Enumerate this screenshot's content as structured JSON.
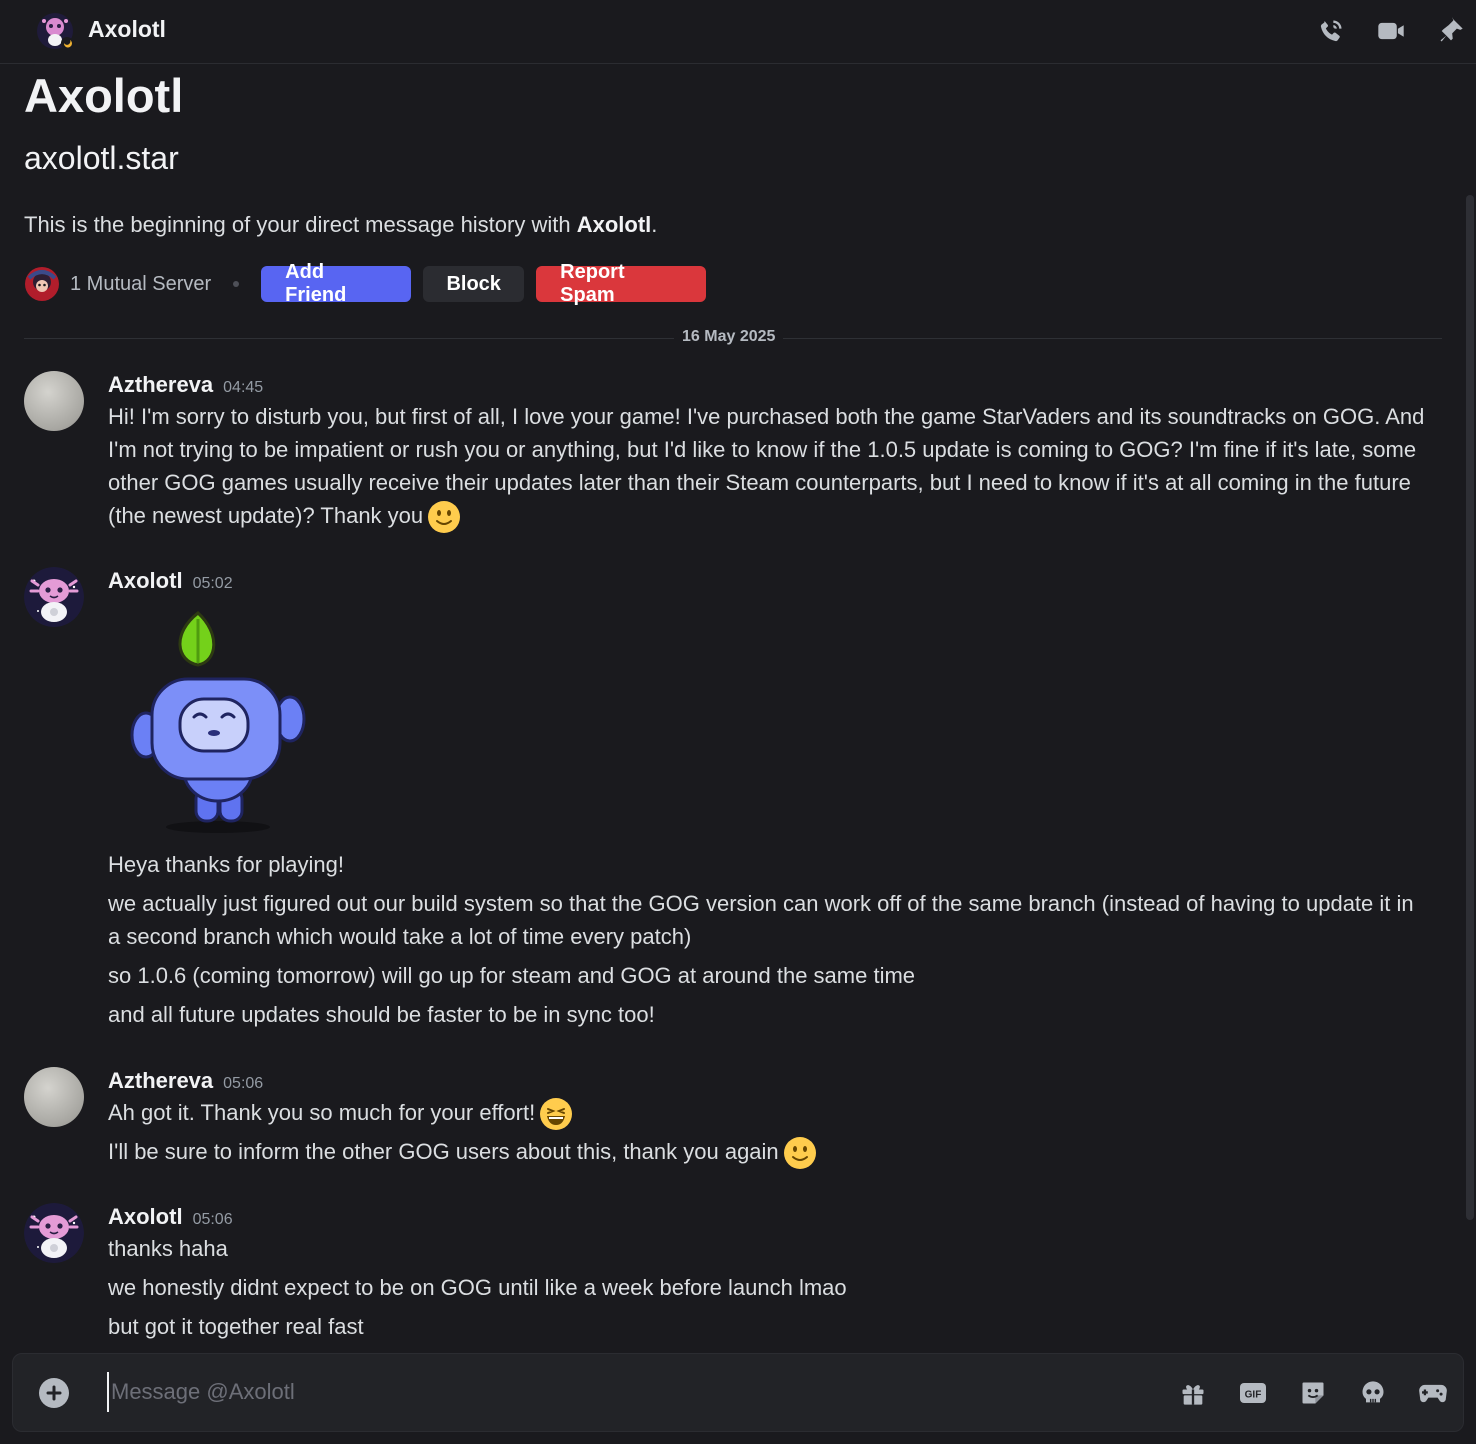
{
  "header": {
    "title": "Axolotl",
    "icons": [
      "phone-call-icon",
      "video-camera-icon",
      "pin-icon"
    ]
  },
  "intro": {
    "display_name": "Axolotl",
    "username": "axolotl.star",
    "beginning_prefix": "This is the beginning of your direct message history with ",
    "beginning_name": "Axolotl",
    "beginning_suffix": ".",
    "mutual_servers": "1 Mutual Server",
    "add_friend": "Add Friend",
    "block": "Block",
    "report_spam": "Report Spam"
  },
  "date_divider": "16 May 2025",
  "messages": [
    {
      "author": "Azthereva",
      "time": "04:45",
      "lines": [
        "Hi! I'm sorry to disturb you, but first of all, I love your game! I've purchased both the game StarVaders and its soundtracks on GOG. And I'm not trying to be impatient or rush you or anything, but I'd like to know if the 1.0.5 update is coming to GOG? I'm fine if it's late, some other GOG games usually receive their updates later than their Steam counterparts, but I need to know if it's at all coming in the future (the newest update)? Thank you"
      ]
    },
    {
      "author": "Axolotl",
      "time": "05:02",
      "sticker": "wumpus-waving-leaf-sticker",
      "lines": [
        "Heya thanks for playing!",
        "we actually just figured out our build system so that the GOG version can work off of the same branch (instead of having to update it in a second branch which would take a lot of time every patch)",
        "so 1.0.6 (coming tomorrow) will go up for steam and GOG at around the same time",
        "and all future updates should be faster to be in sync too!"
      ]
    },
    {
      "author": "Azthereva",
      "time": "05:06",
      "lines": [
        "Ah got it. Thank you so much for your effort!",
        "I'll be sure to inform the other GOG users about this, thank you again"
      ]
    },
    {
      "author": "Axolotl",
      "time": "05:06",
      "lines": [
        "thanks haha",
        "we honestly didnt expect to be on GOG until like a week before launch lmao",
        "but got it together real fast"
      ]
    }
  ],
  "composer": {
    "placeholder": "Message @Axolotl",
    "icons": [
      "gift-icon",
      "gif-icon",
      "sticker-icon",
      "emoji-icon",
      "activities-icon"
    ],
    "gif_label": "GIF"
  },
  "colors": {
    "background": "#1a1a1e",
    "blurple": "#5865f2",
    "danger": "#da373c"
  }
}
